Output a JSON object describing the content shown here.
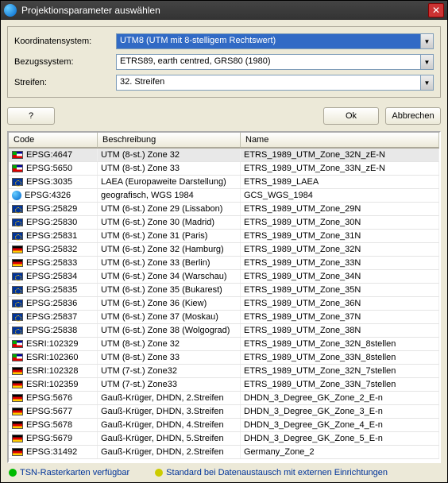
{
  "window": {
    "title": "Projektionsparameter auswählen"
  },
  "form": {
    "coord_label": "Koordinatensystem:",
    "coord_value": "UTM8 (UTM mit 8-stelligem Rechtswert)",
    "ref_label": "Bezugssystem:",
    "ref_value": "ETRS89, earth centred, GRS80 (1980)",
    "strip_label": "Streifen:",
    "strip_value": "32. Streifen"
  },
  "buttons": {
    "help": "?",
    "ok": "Ok",
    "cancel": "Abbrechen"
  },
  "columns": {
    "code": "Code",
    "desc": "Beschreibung",
    "name": "Name"
  },
  "rows": [
    {
      "flag": "de-nw",
      "code": "EPSG:4647",
      "desc": "UTM (8-st.) Zone 32",
      "name": "ETRS_1989_UTM_Zone_32N_zE-N",
      "sel": true
    },
    {
      "flag": "de-nw",
      "code": "EPSG:5650",
      "desc": "UTM (8-st.) Zone 33",
      "name": "ETRS_1989_UTM_Zone_33N_zE-N"
    },
    {
      "flag": "eu",
      "code": "EPSG:3035",
      "desc": "LAEA (Europaweite Darstellung)",
      "name": "ETRS_1989_LAEA"
    },
    {
      "flag": "globe",
      "code": "EPSG:4326",
      "desc": "geografisch, WGS 1984",
      "name": "GCS_WGS_1984"
    },
    {
      "flag": "eu",
      "code": "EPSG:25829",
      "desc": "UTM (6-st.) Zone 29 (Lissabon)",
      "name": "ETRS_1989_UTM_Zone_29N"
    },
    {
      "flag": "eu",
      "code": "EPSG:25830",
      "desc": "UTM (6-st.) Zone 30 (Madrid)",
      "name": "ETRS_1989_UTM_Zone_30N"
    },
    {
      "flag": "eu",
      "code": "EPSG:25831",
      "desc": "UTM (6-st.) Zone 31 (Paris)",
      "name": "ETRS_1989_UTM_Zone_31N"
    },
    {
      "flag": "de",
      "code": "EPSG:25832",
      "desc": "UTM (6-st.) Zone 32 (Hamburg)",
      "name": "ETRS_1989_UTM_Zone_32N"
    },
    {
      "flag": "de",
      "code": "EPSG:25833",
      "desc": "UTM (6-st.) Zone 33 (Berlin)",
      "name": "ETRS_1989_UTM_Zone_33N"
    },
    {
      "flag": "eu",
      "code": "EPSG:25834",
      "desc": "UTM (6-st.) Zone 34 (Warschau)",
      "name": "ETRS_1989_UTM_Zone_34N"
    },
    {
      "flag": "eu",
      "code": "EPSG:25835",
      "desc": "UTM (6-st.) Zone 35 (Bukarest)",
      "name": "ETRS_1989_UTM_Zone_35N"
    },
    {
      "flag": "eu",
      "code": "EPSG:25836",
      "desc": "UTM (6-st.) Zone 36 (Kiew)",
      "name": "ETRS_1989_UTM_Zone_36N"
    },
    {
      "flag": "eu",
      "code": "EPSG:25837",
      "desc": "UTM (6-st.) Zone 37 (Moskau)",
      "name": "ETRS_1989_UTM_Zone_37N"
    },
    {
      "flag": "eu",
      "code": "EPSG:25838",
      "desc": "UTM (6-st.) Zone 38 (Wolgograd)",
      "name": "ETRS_1989_UTM_Zone_38N"
    },
    {
      "flag": "de-nw",
      "code": "ESRI:102329",
      "desc": "UTM (8-st.) Zone 32",
      "name": "ETRS_1989_UTM_Zone_32N_8stellen"
    },
    {
      "flag": "de-nw",
      "code": "ESRI:102360",
      "desc": "UTM (8-st.) Zone 33",
      "name": "ETRS_1989_UTM_Zone_33N_8stellen"
    },
    {
      "flag": "de",
      "code": "ESRI:102328",
      "desc": "UTM (7-st.) Zone32",
      "name": "ETRS_1989_UTM_Zone_32N_7stellen"
    },
    {
      "flag": "de",
      "code": "ESRI:102359",
      "desc": "UTM (7-st.) Zone33",
      "name": "ETRS_1989_UTM_Zone_33N_7stellen"
    },
    {
      "flag": "de",
      "code": "EPSG:5676",
      "desc": "Gauß-Krüger, DHDN, 2.Streifen",
      "name": "DHDN_3_Degree_GK_Zone_2_E-n"
    },
    {
      "flag": "de",
      "code": "EPSG:5677",
      "desc": "Gauß-Krüger, DHDN, 3.Streifen",
      "name": "DHDN_3_Degree_GK_Zone_3_E-n"
    },
    {
      "flag": "de",
      "code": "EPSG:5678",
      "desc": "Gauß-Krüger, DHDN, 4.Streifen",
      "name": "DHDN_3_Degree_GK_Zone_4_E-n"
    },
    {
      "flag": "de",
      "code": "EPSG:5679",
      "desc": "Gauß-Krüger, DHDN, 5.Streifen",
      "name": "DHDN_3_Degree_GK_Zone_5_E-n"
    },
    {
      "flag": "de",
      "code": "EPSG:31492",
      "desc": "Gauß-Krüger, DHDN, 2.Streifen",
      "name": "Germany_Zone_2"
    }
  ],
  "footer": {
    "legend_green": "TSN-Rasterkarten verfügbar",
    "legend_yellow": "Standard bei Datenaustausch mit externen Einrichtungen"
  }
}
